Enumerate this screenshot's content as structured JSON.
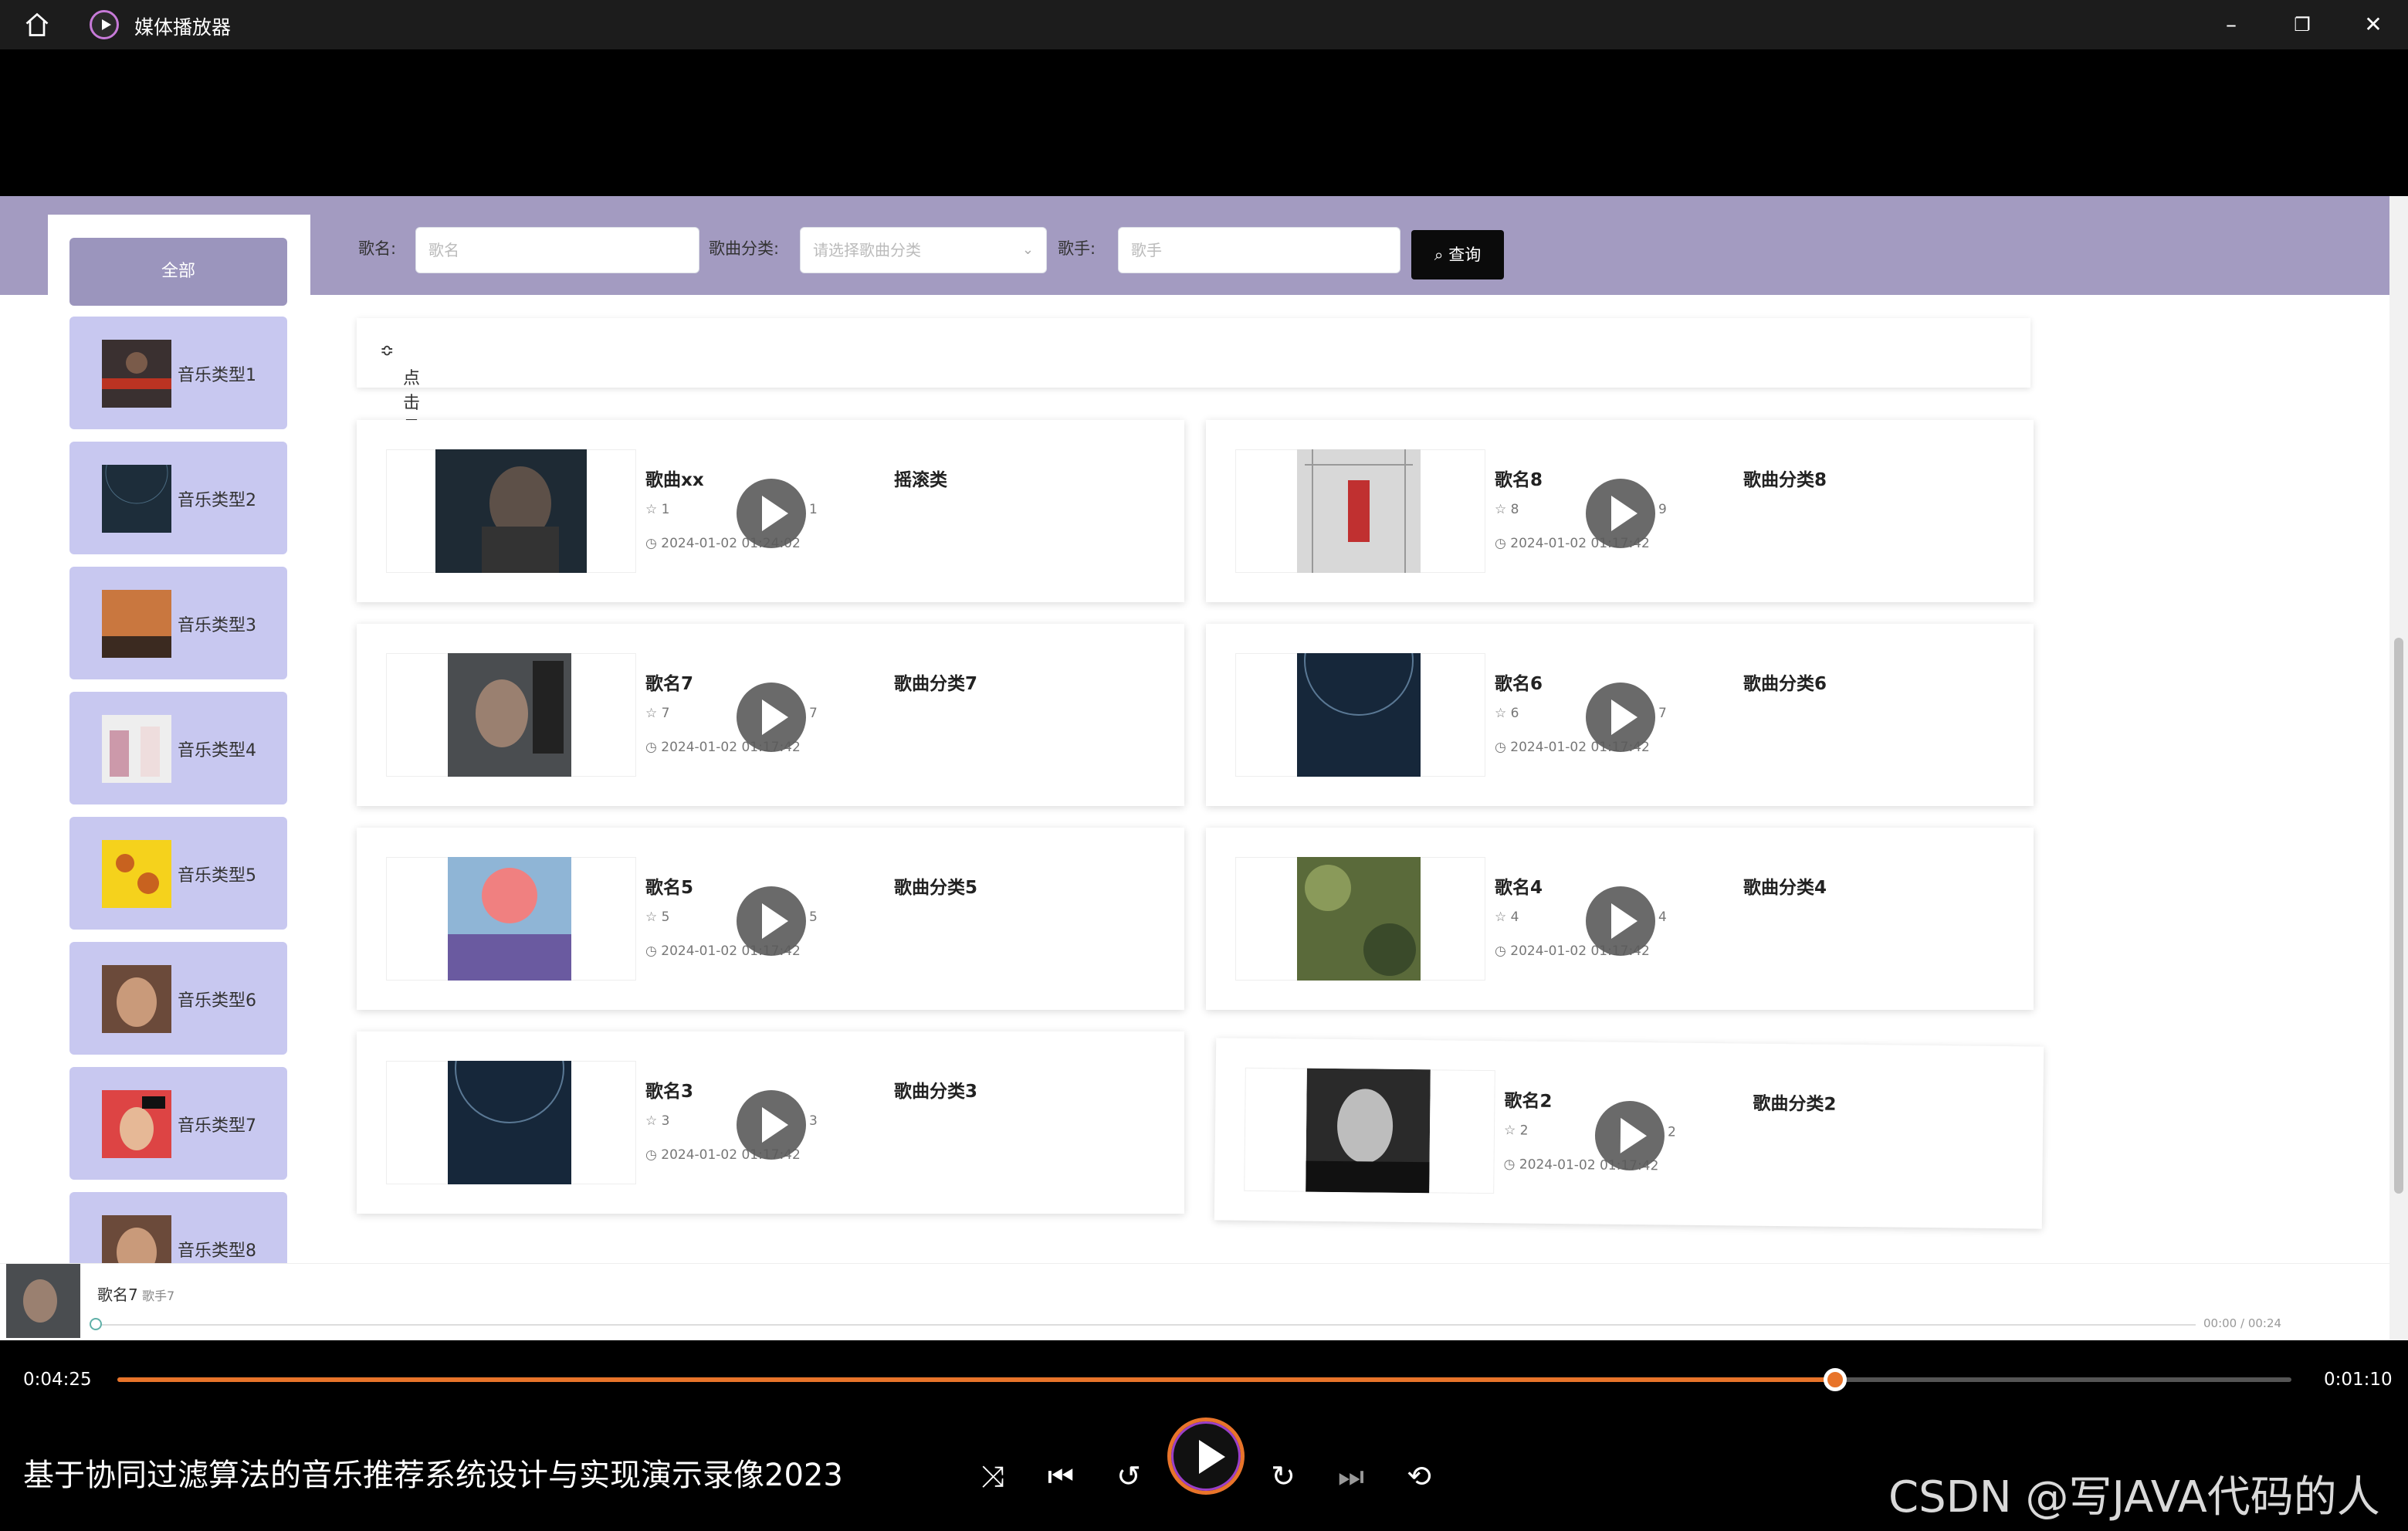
{
  "app": {
    "title": "媒体播放器"
  },
  "sidebar": {
    "all_label": "全部",
    "items": [
      {
        "label": "音乐类型1"
      },
      {
        "label": "音乐类型2"
      },
      {
        "label": "音乐类型3"
      },
      {
        "label": "音乐类型4"
      },
      {
        "label": "音乐类型5"
      },
      {
        "label": "音乐类型6"
      },
      {
        "label": "音乐类型7"
      },
      {
        "label": "音乐类型8"
      }
    ]
  },
  "search": {
    "song_label": "歌名:",
    "song_placeholder": "歌名",
    "category_label": "歌曲分类:",
    "category_placeholder": "请选择歌曲分类",
    "singer_label": "歌手:",
    "singer_placeholder": "歌手",
    "query_button": "查询"
  },
  "sort": {
    "label": "点击量"
  },
  "cards": [
    {
      "name": "歌曲xx",
      "category": "摇滚类",
      "stars": "1",
      "count": "1",
      "time": "2024-01-02 01:24:02"
    },
    {
      "name": "歌名8",
      "category": "歌曲分类8",
      "stars": "8",
      "count": "9",
      "time": "2024-01-02 01:17:42"
    },
    {
      "name": "歌名7",
      "category": "歌曲分类7",
      "stars": "7",
      "count": "7",
      "time": "2024-01-02 01:17:42"
    },
    {
      "name": "歌名6",
      "category": "歌曲分类6",
      "stars": "6",
      "count": "7",
      "time": "2024-01-02 01:17:42"
    },
    {
      "name": "歌名5",
      "category": "歌曲分类5",
      "stars": "5",
      "count": "5",
      "time": "2024-01-02 01:17:42"
    },
    {
      "name": "歌名4",
      "category": "歌曲分类4",
      "stars": "4",
      "count": "4",
      "time": "2024-01-02 01:17:42"
    },
    {
      "name": "歌名3",
      "category": "歌曲分类3",
      "stars": "3",
      "count": "3",
      "time": "2024-01-02 01:17:42"
    },
    {
      "name": "歌名2",
      "category": "歌曲分类2",
      "stars": "2",
      "count": "2",
      "time": "2024-01-02 01:17:42"
    }
  ],
  "mini_player": {
    "song": "歌名7",
    "artist": "歌手7",
    "time": "00:00 / 00:24"
  },
  "player": {
    "elapsed": "0:04:25",
    "total": "0:01:10",
    "progress_fraction": 0.79,
    "video_title": "基于协同过滤算法的音乐推荐系统设计与实现演示录像2023",
    "watermark": "CSDN @写JAVA代码的人",
    "accent_color": "#e8742a"
  }
}
